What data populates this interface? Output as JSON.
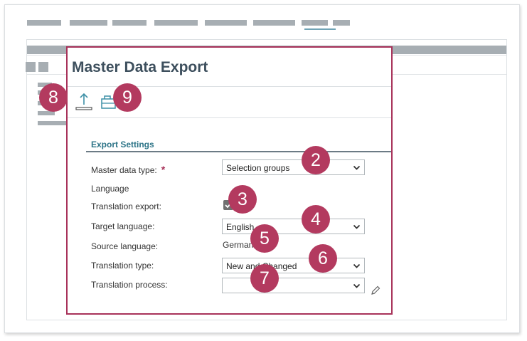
{
  "dialog": {
    "title": "Master Data Export"
  },
  "toolbar": {
    "items": [
      {
        "icon": "upload-export-icon"
      },
      {
        "icon": "briefcase-icon"
      }
    ]
  },
  "form": {
    "section_title": "Export Settings",
    "master_data_type": {
      "label": "Master data type:",
      "required_mark": "*",
      "value": "Selection groups"
    },
    "language_heading": "Language",
    "translation_export": {
      "label": "Translation export:",
      "checked": true
    },
    "target_language": {
      "label": "Target language:",
      "value": "English"
    },
    "source_language": {
      "label": "Source language:",
      "value": "German"
    },
    "translation_type": {
      "label": "Translation type:",
      "value": "New and Changed"
    },
    "translation_process": {
      "label": "Translation process:",
      "value": ""
    }
  },
  "callouts": [
    "8",
    "9",
    "2",
    "3",
    "4",
    "5",
    "6",
    "7"
  ],
  "colors": {
    "accent": "#a8325a",
    "callout": "#b33a5f",
    "teal": "#2e7588",
    "icon": "#3c8fa6",
    "title": "#3d4f5d",
    "placeholder": "#a7aeb3"
  }
}
